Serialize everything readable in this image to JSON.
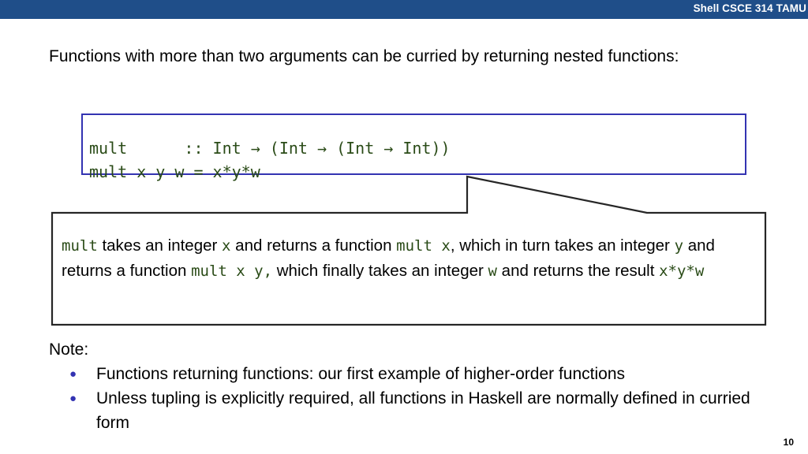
{
  "banner": {
    "title": "Shell CSCE 314 TAMU",
    "background_color": "#1F4E89",
    "text_color": "#FFFFFF"
  },
  "intro": {
    "text": "Functions with more than two arguments can be curried by returning nested functions:"
  },
  "code_box": {
    "border_color": "#3333B2",
    "text_color": "#2A4B17",
    "lines": [
      "mult      :: Int → (Int → (Int → Int))",
      "mult x y w = x*y*w"
    ],
    "text": "mult      :: Int → (Int → (Int → Int))\nmult x y w = x*y*w"
  },
  "callout": {
    "border_color": "#262626",
    "segments": [
      {
        "t": "mult",
        "code": true
      },
      {
        "t": " takes an integer ",
        "code": false
      },
      {
        "t": "x",
        "code": true
      },
      {
        "t": " and returns a function ",
        "code": false
      },
      {
        "t": "mult x",
        "code": true
      },
      {
        "t": ", which in turn takes an integer ",
        "code": false
      },
      {
        "t": "y",
        "code": true
      },
      {
        "t": " and returns a function ",
        "code": false
      },
      {
        "t": "mult x y,",
        "code": true
      },
      {
        "t": " which finally takes an integer ",
        "code": false
      },
      {
        "t": "w",
        "code": true
      },
      {
        "t": " and returns the result ",
        "code": false
      },
      {
        "t": "x*y*w",
        "code": true
      }
    ],
    "plain_text": "mult takes an integer x and returns a function mult x, which in turn takes an integer y and returns a function mult x y, which finally takes an integer w and returns the result x*y*w"
  },
  "notes": {
    "label": "Note:",
    "bullet_glyph": "●",
    "bullet_color": "#3333B2",
    "items": [
      "Functions returning functions: our first example of higher-order functions",
      "Unless tupling is explicitly required, all functions in Haskell are normally defined in curried form"
    ]
  },
  "footer": {
    "page_number": "10"
  }
}
